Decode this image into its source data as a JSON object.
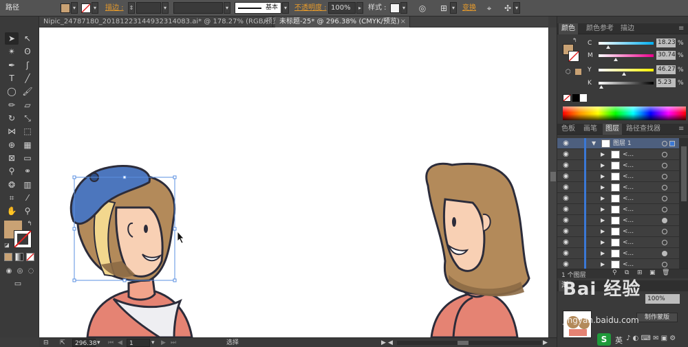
{
  "control_bar": {
    "object_type": "路径",
    "fill_color": "#c9a274",
    "stroke_label": "描边 :",
    "stroke_style_value": "基本",
    "opacity_label": "不透明度 :",
    "opacity_value": "100%",
    "style_label": "样式 :",
    "transform_label": "变换"
  },
  "doc_tabs": [
    {
      "label": "Nipic_24787180_20181223144932314083.ai* @ 178.27% (RGB/预览)",
      "active": false
    },
    {
      "label": "未标题-25* @ 296.38% (CMYK/预览)",
      "active": true
    }
  ],
  "status_bar": {
    "zoom": "296.38",
    "artboard": "1",
    "tool_state": "选择"
  },
  "color_panel": {
    "tabs": [
      "颜色",
      "颜色参考",
      "描边"
    ],
    "channels": [
      {
        "label": "C",
        "value": "18.23",
        "pct": 0.18,
        "gradient": "linear-gradient(90deg,#ffffff,#00aeef)"
      },
      {
        "label": "M",
        "value": "30.74",
        "pct": 0.31,
        "gradient": "linear-gradient(90deg,#ffffff,#ec008c)"
      },
      {
        "label": "Y",
        "value": "46.27",
        "pct": 0.46,
        "gradient": "linear-gradient(90deg,#ffffff,#fff200)"
      },
      {
        "label": "K",
        "value": "5.23",
        "pct": 0.05,
        "gradient": "linear-gradient(90deg,#ffffff,#000000)"
      }
    ],
    "percent_sign": "%"
  },
  "layers_panel": {
    "tabs": [
      "色板",
      "画笔",
      "图层",
      "路径查找器"
    ],
    "top_layer_name": "图层 1",
    "sublayer_label": "<...",
    "sublayers": [
      {
        "target_filled": false
      },
      {
        "target_filled": false
      },
      {
        "target_filled": false
      },
      {
        "target_filled": false
      },
      {
        "target_filled": false
      },
      {
        "target_filled": false
      },
      {
        "target_filled": true
      },
      {
        "target_filled": false
      },
      {
        "target_filled": false
      },
      {
        "target_filled": true
      },
      {
        "target_filled": false
      }
    ],
    "layer_count": "1 个图层"
  },
  "bottom_panel": {
    "tab_partial": "渐",
    "opacity_value": "100%",
    "make_mask_button": "制作蒙版",
    "input_method_label": "英"
  },
  "watermark": {
    "brand": "Bai 经验",
    "url": "jingyan.baidu.com"
  }
}
